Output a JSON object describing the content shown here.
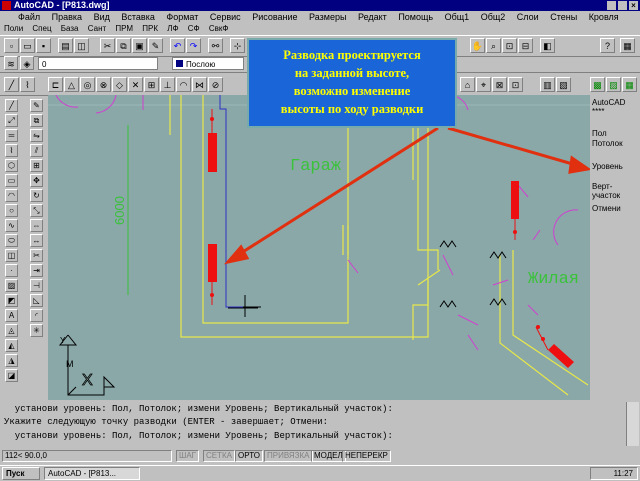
{
  "window": {
    "title": "AutoCAD - [P813.dwg]"
  },
  "menu_main": [
    "Файл",
    "Правка",
    "Вид",
    "Вставка",
    "Формат",
    "Сервис",
    "Рисование",
    "Размеры",
    "Редакт",
    "Помощь",
    "Общ1",
    "Общ2",
    "Слои",
    "Стены",
    "Кровля"
  ],
  "menu_secondary": [
    "Поли",
    "Спец",
    "База",
    "Сант",
    "ПРМ",
    "ПРК",
    "ЛФ",
    "СФ",
    "СвкФ"
  ],
  "layer_toolbar": {
    "layer_value": "0",
    "linetype_value": "Послою"
  },
  "drawing": {
    "room_garage": "Гараж",
    "room_living": "Жилая",
    "dimension": "6000",
    "axis_x": "X",
    "axis_y": "Y",
    "m_label": "M"
  },
  "side_menu": [
    "AutoCAD",
    "****",
    "Пол",
    "Потолок",
    "Уровень",
    "Верт-участок",
    "Отмени"
  ],
  "command_lines": [
    "  установи уровень: Пол, Потолок; измени Уровень; Вертикальный участок):",
    "Укажите следующую точку разводки (ENTER - завершает; Отмени:",
    "  установи уровень: Пол, Потолок; измени Уровень; Вертикальный участок):"
  ],
  "status": {
    "coords": "112< 90.0,0",
    "modes": [
      "ШАГ",
      "СЕТКА",
      "ОРТО",
      "ПРИВЯЗКА",
      "МОДЕЛ",
      "НЕПЕРЕКР"
    ]
  },
  "taskbar": {
    "start": "Пуск",
    "app": "AutoCAD - [P813...",
    "clock": "11:27"
  },
  "callout": {
    "lines": [
      "Разводка проектируется",
      "на заданной высоте,",
      "возможно изменение",
      "высоты по ходу разводки"
    ],
    "color": "#1a66d9",
    "text_color": "#ffff00",
    "arrow_color": "#e03010"
  },
  "icons": [
    "autocad-app-icon",
    "new-file-icon",
    "open-file-icon",
    "save-icon",
    "print-icon",
    "undo-icon",
    "redo-icon",
    "zoom-icon",
    "pan-icon",
    "line-tool-icon",
    "circle-tool-icon",
    "arc-tool-icon",
    "close-icon",
    "minimize-icon",
    "maximize-icon"
  ]
}
